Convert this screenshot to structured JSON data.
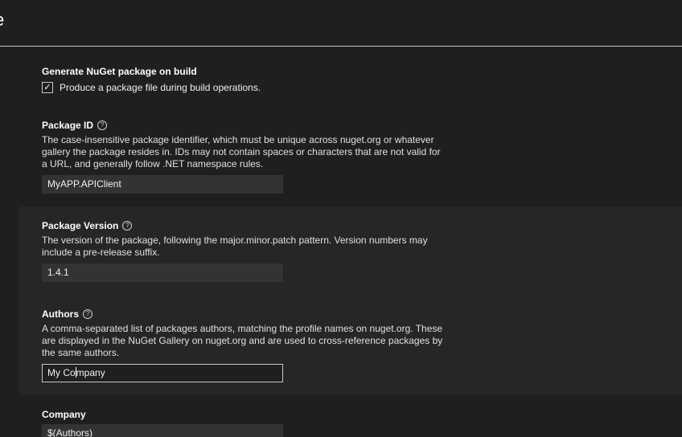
{
  "header": {
    "title": "e"
  },
  "generate": {
    "title": "Generate NuGet package on build",
    "checkbox_label": "Produce a package file during build operations.",
    "checked": true,
    "check_glyph": "✓"
  },
  "package_id": {
    "title": "Package ID",
    "help_glyph": "?",
    "description": "The case-insensitive package identifier, which must be unique across nuget.org or whatever gallery the package resides in. IDs may not contain spaces or characters that are not valid for a URL, and generally follow .NET namespace rules.",
    "value": "MyAPP.APIClient"
  },
  "package_version": {
    "title": "Package Version",
    "help_glyph": "?",
    "description": "The version of the package, following the major.minor.patch pattern. Version numbers may include a pre-release suffix.",
    "value": "1.4.1"
  },
  "authors": {
    "title": "Authors",
    "help_glyph": "?",
    "description": "A comma-separated list of packages authors, matching the profile names on nuget.org. These are displayed in the NuGet Gallery on nuget.org and are used to cross-reference packages by the same authors.",
    "value_before_caret": "My Co",
    "value_after_caret": "mpany"
  },
  "company": {
    "title": "Company",
    "value": "$(Authors)"
  },
  "icons": {
    "help": "help-circle-icon",
    "check": "checkmark-icon"
  },
  "colors": {
    "background": "#1f1f1f",
    "band": "#262626",
    "input_bg": "#333333",
    "focused_border": "#c8c8c8"
  }
}
